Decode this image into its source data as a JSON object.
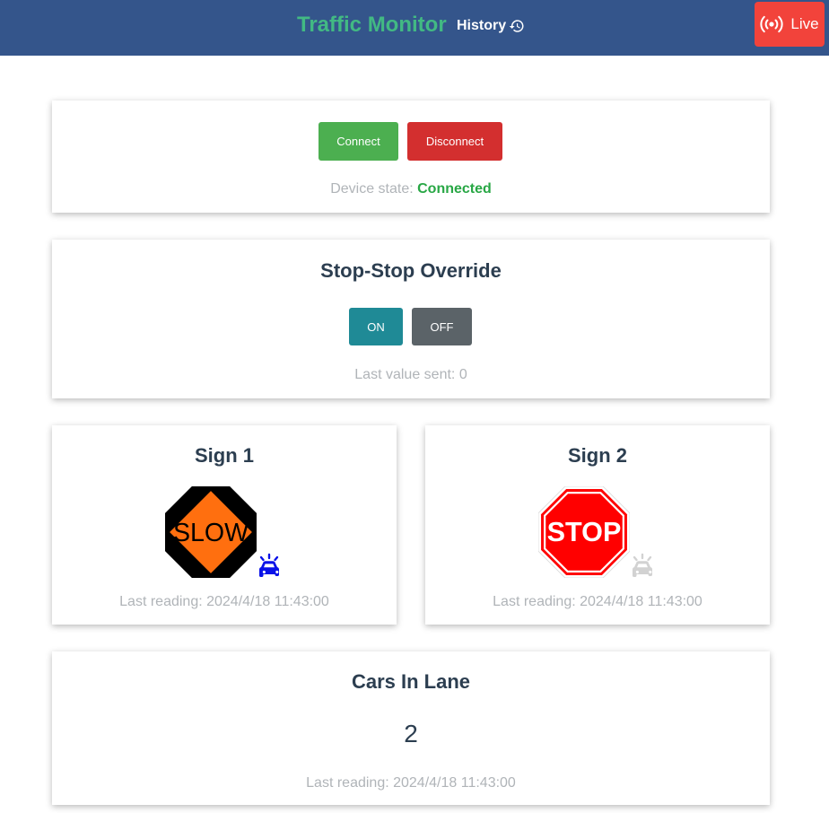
{
  "header": {
    "title": "Traffic Monitor",
    "history_label": "History",
    "live_label": "Live",
    "title_color": "#42b983",
    "bar_color": "#34558b",
    "live_color": "#f2433b"
  },
  "connection": {
    "connect_label": "Connect",
    "disconnect_label": "Disconnect",
    "state_label": "Device state:",
    "state_value": "Connected"
  },
  "override": {
    "title": "Stop-Stop Override",
    "on_label": "ON",
    "off_label": "OFF",
    "last_label": "Last value sent:",
    "last_value": "0"
  },
  "sign1": {
    "title": "Sign 1",
    "sign_text": "SLOW",
    "car_icon": "car-police-light-icon",
    "car_active": true,
    "last_reading": "Last reading: 2024/4/18 11:43:00"
  },
  "sign2": {
    "title": "Sign 2",
    "sign_text": "STOP",
    "car_icon": "car-police-light-icon",
    "car_active": false,
    "last_reading": "Last reading: 2024/4/18 11:43:00"
  },
  "cars": {
    "title": "Cars In Lane",
    "count": "2",
    "last_reading": "Last reading: 2024/4/18 11:43:00"
  }
}
